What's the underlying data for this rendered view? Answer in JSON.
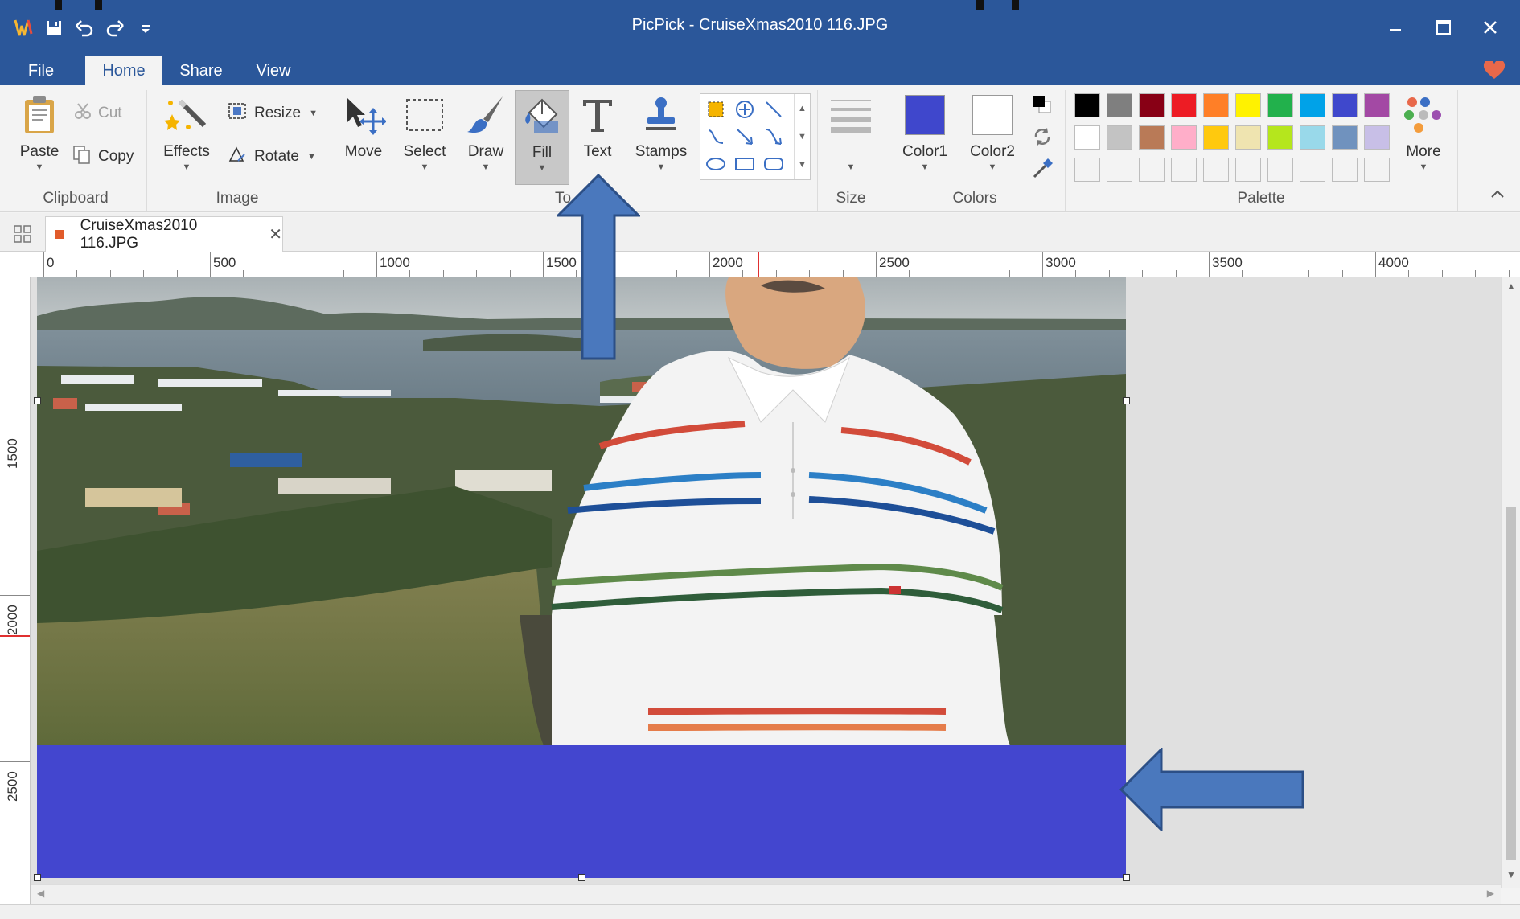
{
  "window": {
    "title": "PicPick - CruiseXmas2010 116.JPG"
  },
  "menu": {
    "tabs": [
      "File",
      "Home",
      "Share",
      "View"
    ],
    "active": "Home"
  },
  "ribbon": {
    "clipboard": {
      "label": "Clipboard",
      "paste": "Paste",
      "cut": "Cut",
      "copy": "Copy"
    },
    "image": {
      "label": "Image",
      "effects": "Effects",
      "resize": "Resize",
      "rotate": "Rotate"
    },
    "tools": {
      "label": "To",
      "move": "Move",
      "select": "Select",
      "draw": "Draw",
      "fill": "Fill",
      "text": "Text",
      "stamps": "Stamps"
    },
    "size": {
      "label": "Size"
    },
    "colors": {
      "label": "Colors",
      "color1": "Color1",
      "color2": "Color2",
      "color1_value": "#3f47cc",
      "color2_value": "#ffffff"
    },
    "palette": {
      "label": "Palette",
      "more": "More",
      "row1": [
        "#000000",
        "#7f7f7f",
        "#880015",
        "#ed1c24",
        "#ff7f27",
        "#fff200",
        "#22b14c",
        "#00a2e8",
        "#3f48cc",
        "#a349a4"
      ],
      "row2": [
        "#ffffff",
        "#c3c3c3",
        "#b97a57",
        "#ffaec9",
        "#ffc90e",
        "#efe4b0",
        "#b5e61d",
        "#99d9ea",
        "#7092be",
        "#c8bfe7"
      ],
      "row3": [
        "#f3f3f3",
        "#f3f3f3",
        "#f3f3f3",
        "#f3f3f3",
        "#f3f3f3",
        "#f3f3f3",
        "#f3f3f3",
        "#f3f3f3",
        "#f3f3f3",
        "#f3f3f3"
      ]
    }
  },
  "document": {
    "tab_name": "CruiseXmas2010 116.JPG",
    "fill_color": "#4346cf"
  },
  "ruler": {
    "horizontal": [
      "0",
      "500",
      "1000",
      "1500",
      "2000",
      "2500",
      "3000",
      "3500",
      "4000"
    ],
    "vertical": [
      "1500",
      "2000",
      "2500"
    ]
  },
  "icons": {
    "app": "picpick-logo-icon",
    "save": "save-icon",
    "undo": "undo-icon",
    "redo": "redo-icon",
    "customize": "customize-quick-access-icon",
    "minimize": "minimize-icon",
    "maximize": "maximize-icon",
    "close": "close-icon",
    "favorite": "heart-icon"
  }
}
